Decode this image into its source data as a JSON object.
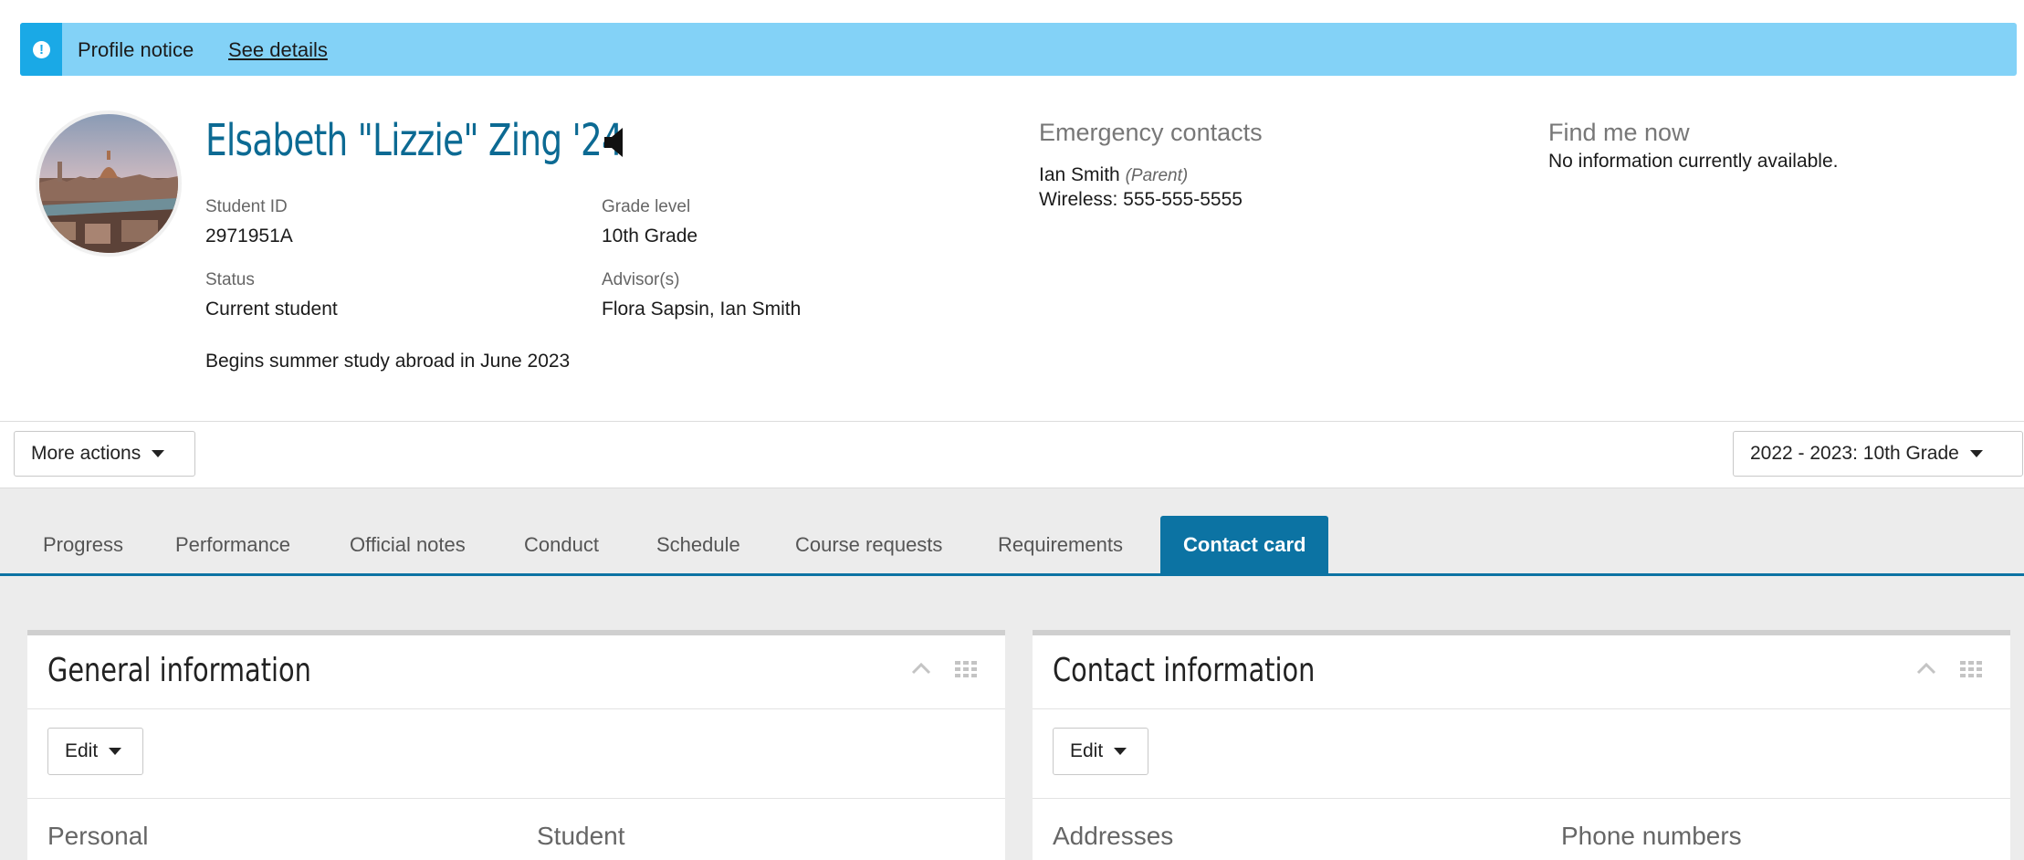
{
  "notice": {
    "title": "Profile notice",
    "link": "See details",
    "icon": "exclamation-circle-icon",
    "colors": {
      "background": "#83d2f7",
      "icon_box": "#1aa9e6"
    }
  },
  "profile": {
    "name": "Elsabeth \"Lizzie\" Zing '24",
    "student_id": {
      "label": "Student ID",
      "value": "2971951A"
    },
    "grade_level": {
      "label": "Grade level",
      "value": "10th Grade"
    },
    "status": {
      "label": "Status",
      "value": "Current student"
    },
    "advisors": {
      "label": "Advisor(s)",
      "value": "Flora Sapsin, Ian Smith"
    },
    "note": "Begins summer study abroad in June 2023",
    "name_color": "#0c6a93"
  },
  "emergency": {
    "title": "Emergency contacts",
    "contact_name": "Ian Smith",
    "relation": "(Parent)",
    "phone": "Wireless: 555-555-5555"
  },
  "find_me": {
    "title": "Find me now",
    "text": "No information currently available."
  },
  "toolbar": {
    "more_actions": "More actions",
    "year_select": "2022 - 2023: 10th Grade"
  },
  "tabs": [
    {
      "label": "Progress"
    },
    {
      "label": "Performance"
    },
    {
      "label": "Official notes"
    },
    {
      "label": "Conduct"
    },
    {
      "label": "Schedule"
    },
    {
      "label": "Course requests"
    },
    {
      "label": "Requirements"
    },
    {
      "label": "Contact card",
      "active": true
    }
  ],
  "panels": {
    "general": {
      "title": "General information",
      "edit": "Edit",
      "col1": "Personal",
      "col2": "Student"
    },
    "contact": {
      "title": "Contact information",
      "edit": "Edit",
      "col1": "Addresses",
      "col2": "Phone numbers"
    }
  },
  "accent_color": "#0c73a3"
}
